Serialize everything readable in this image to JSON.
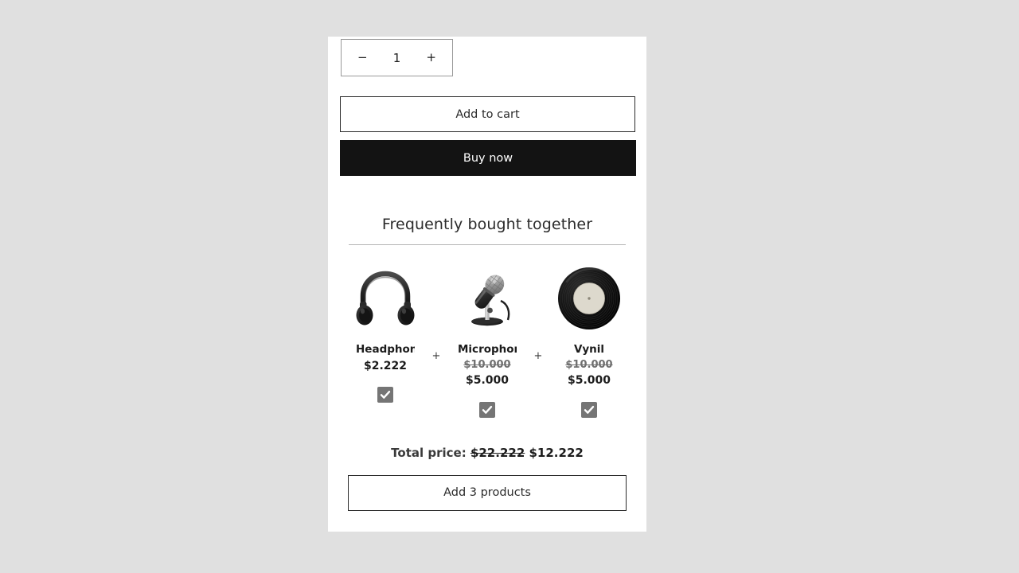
{
  "background_color": "#e0e0e0",
  "page_background": "#ffffff",
  "product_form": {
    "quantity": {
      "decrease_label": "−",
      "value": "1",
      "increase_label": "+"
    },
    "add_to_cart_label": "Add to cart",
    "buy_now_label": "Buy now",
    "buy_now_bg": "#131313"
  },
  "frequently_bought_together": {
    "title": "Frequently bought together",
    "plus_separator": "+",
    "items": [
      {
        "name": "Headphon",
        "icon": "headphones-image",
        "old_price": "",
        "price": "$2.222",
        "checked": true
      },
      {
        "name": "Microphoı",
        "icon": "microphone-image",
        "old_price": "$10.000",
        "price": "$5.000",
        "checked": true
      },
      {
        "name": "Vynil",
        "icon": "vinyl-record-image",
        "old_price": "$10.000",
        "price": "$5.000",
        "checked": true
      }
    ],
    "total": {
      "label": "Total price:",
      "old_price": "$22.222",
      "price": "$12.222"
    },
    "add_products_label": "Add 3 products",
    "checkbox_color": "#757575"
  }
}
